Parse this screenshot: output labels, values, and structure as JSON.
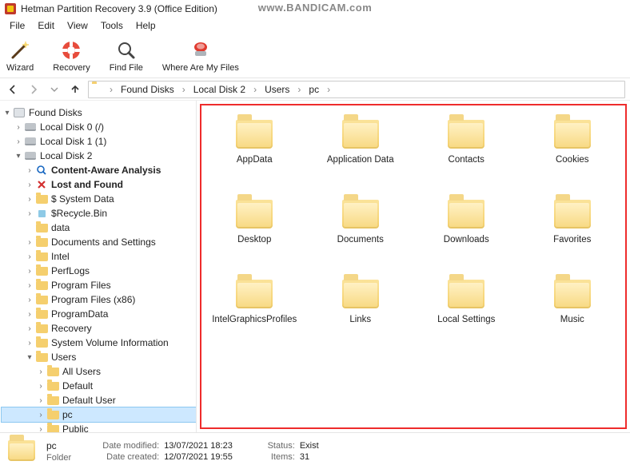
{
  "app": {
    "title": "Hetman Partition Recovery 3.9 (Office Edition)",
    "watermark": "www.BANDICAM.com"
  },
  "menu": {
    "file": "File",
    "edit": "Edit",
    "view": "View",
    "tools": "Tools",
    "help": "Help"
  },
  "toolbar": {
    "wizard": "Wizard",
    "recovery": "Recovery",
    "findfile": "Find File",
    "wheremyfiles": "Where Are My Files"
  },
  "breadcrumb": {
    "items": [
      "Found Disks",
      "Local Disk 2",
      "Users",
      "pc"
    ]
  },
  "tree": {
    "root": "Found Disks",
    "disk0": "Local Disk 0 (/)",
    "disk1": "Local Disk 1 (1)",
    "disk2": "Local Disk 2",
    "contentaware": "Content-Aware Analysis",
    "lostfound": "Lost and Found",
    "systemdata": "$ System Data",
    "recyclebin": "$Recycle.Bin",
    "data": "data",
    "docset": "Documents and Settings",
    "intel": "Intel",
    "perflogs": "PerfLogs",
    "progfiles": "Program Files",
    "progfilesx86": "Program Files (x86)",
    "programdata": "ProgramData",
    "recovery": "Recovery",
    "sysvol": "System Volume Information",
    "users": "Users",
    "allusers": "All Users",
    "default": "Default",
    "defaultuser": "Default User",
    "pc": "pc",
    "public": "Public"
  },
  "folders": [
    {
      "name": "AppData"
    },
    {
      "name": "Application Data"
    },
    {
      "name": "Contacts"
    },
    {
      "name": "Cookies"
    },
    {
      "name": "Desktop"
    },
    {
      "name": "Documents"
    },
    {
      "name": "Downloads"
    },
    {
      "name": "Favorites"
    },
    {
      "name": "IntelGraphicsProfiles"
    },
    {
      "name": "Links"
    },
    {
      "name": "Local Settings"
    },
    {
      "name": "Music"
    }
  ],
  "status": {
    "name": "pc",
    "type": "Folder",
    "date_modified_label": "Date modified:",
    "date_modified": "13/07/2021 18:23",
    "date_created_label": "Date created:",
    "date_created": "12/07/2021 19:55",
    "status_label": "Status:",
    "status_value": "Exist",
    "items_label": "Items:",
    "items_value": "31"
  }
}
